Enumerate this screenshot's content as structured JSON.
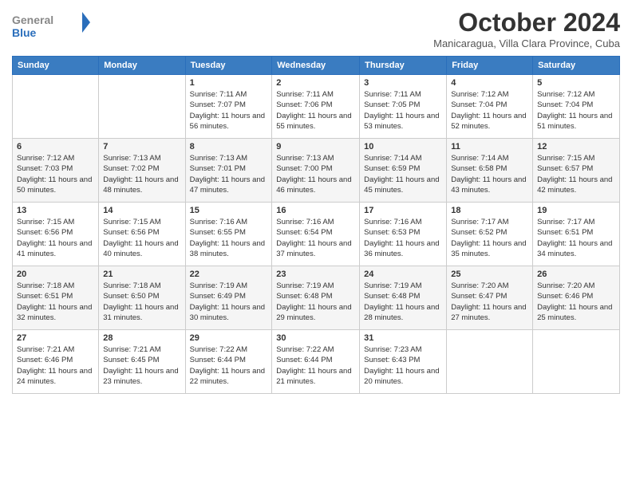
{
  "header": {
    "logo": {
      "general": "General",
      "blue": "Blue"
    },
    "title": "October 2024",
    "location": "Manicaragua, Villa Clara Province, Cuba"
  },
  "calendar": {
    "weekdays": [
      "Sunday",
      "Monday",
      "Tuesday",
      "Wednesday",
      "Thursday",
      "Friday",
      "Saturday"
    ],
    "weeks": [
      [
        {
          "day": "",
          "sunrise": "",
          "sunset": "",
          "daylight": ""
        },
        {
          "day": "",
          "sunrise": "",
          "sunset": "",
          "daylight": ""
        },
        {
          "day": "1",
          "sunrise": "Sunrise: 7:11 AM",
          "sunset": "Sunset: 7:07 PM",
          "daylight": "Daylight: 11 hours and 56 minutes."
        },
        {
          "day": "2",
          "sunrise": "Sunrise: 7:11 AM",
          "sunset": "Sunset: 7:06 PM",
          "daylight": "Daylight: 11 hours and 55 minutes."
        },
        {
          "day": "3",
          "sunrise": "Sunrise: 7:11 AM",
          "sunset": "Sunset: 7:05 PM",
          "daylight": "Daylight: 11 hours and 53 minutes."
        },
        {
          "day": "4",
          "sunrise": "Sunrise: 7:12 AM",
          "sunset": "Sunset: 7:04 PM",
          "daylight": "Daylight: 11 hours and 52 minutes."
        },
        {
          "day": "5",
          "sunrise": "Sunrise: 7:12 AM",
          "sunset": "Sunset: 7:04 PM",
          "daylight": "Daylight: 11 hours and 51 minutes."
        }
      ],
      [
        {
          "day": "6",
          "sunrise": "Sunrise: 7:12 AM",
          "sunset": "Sunset: 7:03 PM",
          "daylight": "Daylight: 11 hours and 50 minutes."
        },
        {
          "day": "7",
          "sunrise": "Sunrise: 7:13 AM",
          "sunset": "Sunset: 7:02 PM",
          "daylight": "Daylight: 11 hours and 48 minutes."
        },
        {
          "day": "8",
          "sunrise": "Sunrise: 7:13 AM",
          "sunset": "Sunset: 7:01 PM",
          "daylight": "Daylight: 11 hours and 47 minutes."
        },
        {
          "day": "9",
          "sunrise": "Sunrise: 7:13 AM",
          "sunset": "Sunset: 7:00 PM",
          "daylight": "Daylight: 11 hours and 46 minutes."
        },
        {
          "day": "10",
          "sunrise": "Sunrise: 7:14 AM",
          "sunset": "Sunset: 6:59 PM",
          "daylight": "Daylight: 11 hours and 45 minutes."
        },
        {
          "day": "11",
          "sunrise": "Sunrise: 7:14 AM",
          "sunset": "Sunset: 6:58 PM",
          "daylight": "Daylight: 11 hours and 43 minutes."
        },
        {
          "day": "12",
          "sunrise": "Sunrise: 7:15 AM",
          "sunset": "Sunset: 6:57 PM",
          "daylight": "Daylight: 11 hours and 42 minutes."
        }
      ],
      [
        {
          "day": "13",
          "sunrise": "Sunrise: 7:15 AM",
          "sunset": "Sunset: 6:56 PM",
          "daylight": "Daylight: 11 hours and 41 minutes."
        },
        {
          "day": "14",
          "sunrise": "Sunrise: 7:15 AM",
          "sunset": "Sunset: 6:56 PM",
          "daylight": "Daylight: 11 hours and 40 minutes."
        },
        {
          "day": "15",
          "sunrise": "Sunrise: 7:16 AM",
          "sunset": "Sunset: 6:55 PM",
          "daylight": "Daylight: 11 hours and 38 minutes."
        },
        {
          "day": "16",
          "sunrise": "Sunrise: 7:16 AM",
          "sunset": "Sunset: 6:54 PM",
          "daylight": "Daylight: 11 hours and 37 minutes."
        },
        {
          "day": "17",
          "sunrise": "Sunrise: 7:16 AM",
          "sunset": "Sunset: 6:53 PM",
          "daylight": "Daylight: 11 hours and 36 minutes."
        },
        {
          "day": "18",
          "sunrise": "Sunrise: 7:17 AM",
          "sunset": "Sunset: 6:52 PM",
          "daylight": "Daylight: 11 hours and 35 minutes."
        },
        {
          "day": "19",
          "sunrise": "Sunrise: 7:17 AM",
          "sunset": "Sunset: 6:51 PM",
          "daylight": "Daylight: 11 hours and 34 minutes."
        }
      ],
      [
        {
          "day": "20",
          "sunrise": "Sunrise: 7:18 AM",
          "sunset": "Sunset: 6:51 PM",
          "daylight": "Daylight: 11 hours and 32 minutes."
        },
        {
          "day": "21",
          "sunrise": "Sunrise: 7:18 AM",
          "sunset": "Sunset: 6:50 PM",
          "daylight": "Daylight: 11 hours and 31 minutes."
        },
        {
          "day": "22",
          "sunrise": "Sunrise: 7:19 AM",
          "sunset": "Sunset: 6:49 PM",
          "daylight": "Daylight: 11 hours and 30 minutes."
        },
        {
          "day": "23",
          "sunrise": "Sunrise: 7:19 AM",
          "sunset": "Sunset: 6:48 PM",
          "daylight": "Daylight: 11 hours and 29 minutes."
        },
        {
          "day": "24",
          "sunrise": "Sunrise: 7:19 AM",
          "sunset": "Sunset: 6:48 PM",
          "daylight": "Daylight: 11 hours and 28 minutes."
        },
        {
          "day": "25",
          "sunrise": "Sunrise: 7:20 AM",
          "sunset": "Sunset: 6:47 PM",
          "daylight": "Daylight: 11 hours and 27 minutes."
        },
        {
          "day": "26",
          "sunrise": "Sunrise: 7:20 AM",
          "sunset": "Sunset: 6:46 PM",
          "daylight": "Daylight: 11 hours and 25 minutes."
        }
      ],
      [
        {
          "day": "27",
          "sunrise": "Sunrise: 7:21 AM",
          "sunset": "Sunset: 6:46 PM",
          "daylight": "Daylight: 11 hours and 24 minutes."
        },
        {
          "day": "28",
          "sunrise": "Sunrise: 7:21 AM",
          "sunset": "Sunset: 6:45 PM",
          "daylight": "Daylight: 11 hours and 23 minutes."
        },
        {
          "day": "29",
          "sunrise": "Sunrise: 7:22 AM",
          "sunset": "Sunset: 6:44 PM",
          "daylight": "Daylight: 11 hours and 22 minutes."
        },
        {
          "day": "30",
          "sunrise": "Sunrise: 7:22 AM",
          "sunset": "Sunset: 6:44 PM",
          "daylight": "Daylight: 11 hours and 21 minutes."
        },
        {
          "day": "31",
          "sunrise": "Sunrise: 7:23 AM",
          "sunset": "Sunset: 6:43 PM",
          "daylight": "Daylight: 11 hours and 20 minutes."
        },
        {
          "day": "",
          "sunrise": "",
          "sunset": "",
          "daylight": ""
        },
        {
          "day": "",
          "sunrise": "",
          "sunset": "",
          "daylight": ""
        }
      ]
    ]
  }
}
